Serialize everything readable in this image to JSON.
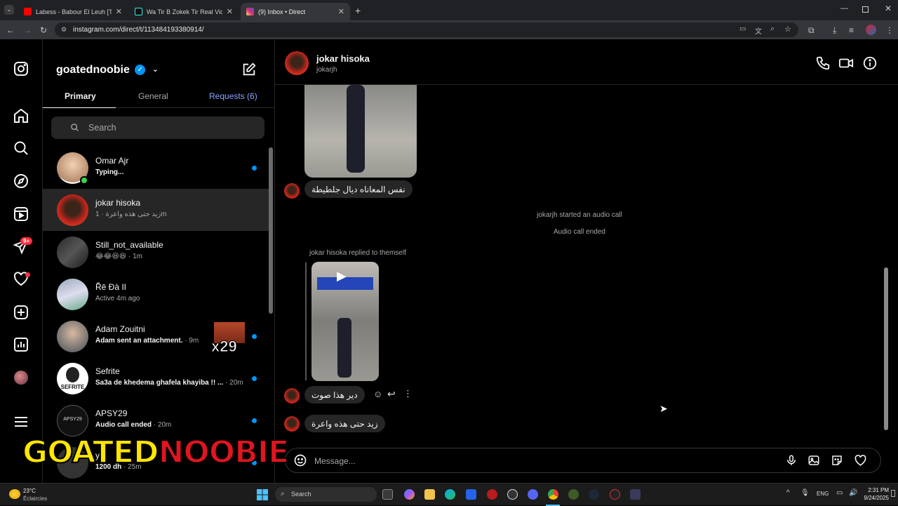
{
  "browser": {
    "tabs": [
      {
        "title": "Labess - Babour El Leuh [Tout v",
        "active": false
      },
      {
        "title": "Wa Tir B Zokek Tir Real Video |",
        "active": false
      },
      {
        "title": "(9) Inbox • Direct",
        "active": true
      }
    ],
    "url": "instagram.com/direct/t/113484193380914/"
  },
  "nav": {
    "notifications_badge": "9+"
  },
  "inbox": {
    "username": "goatednoobie",
    "tabs": {
      "primary": "Primary",
      "general": "General",
      "requests": "Requests (6)"
    },
    "search_placeholder": "Search",
    "threads": [
      {
        "name": "Omar Ajr",
        "preview": "Typing...",
        "time": "",
        "unread": true
      },
      {
        "name": "jokar hisoka",
        "preview": "زيد حتى هذه واعرة",
        "time": " · 1m",
        "unread": false
      },
      {
        "name": "Still_not_available",
        "preview": "😂😂😆😆",
        "time": " · 1m",
        "unread": false
      },
      {
        "name": "Ř̈ē Đà II",
        "preview": "Active 4m ago",
        "time": "",
        "unread": false
      },
      {
        "name": "Adam Zouitni",
        "preview": "Adam sent an attachment.",
        "time": " · 9m",
        "unread": true
      },
      {
        "name": "Sefrite",
        "preview": "Sa3a de khedema ghafela khayiba !! ...",
        "time": " · 20m",
        "unread": true
      },
      {
        "name": "APSY29",
        "preview": "Audio call ended",
        "time": " · 20m",
        "unread": true
      },
      {
        "name": "y",
        "preview": "1200 dh",
        "time": " · 25m",
        "unread": true
      }
    ],
    "sticker_count": "x29",
    "avatar_labels": {
      "sefrite": "SEFRITE",
      "apsy": "APSY29"
    }
  },
  "chat": {
    "name": "jokar hisoka",
    "handle": "jokarjh",
    "messages": {
      "first": "نفس المعاناه ديال جلطيطة",
      "call_started": "jokarjh started an audio call",
      "call_ended": "Audio call ended",
      "replied": "jokar hisoka replied to themself",
      "second": "دير هذا صوت",
      "third": "زيد حتى هذه واعرة"
    },
    "message_placeholder": "Message..."
  },
  "overlay": {
    "part1": "GOATED",
    "part2": "NOOBIE"
  },
  "taskbar": {
    "temperature": "23°C",
    "weather": "Éclaircies",
    "search": "Search",
    "language": "ENG",
    "time": "2:31 PM",
    "date": "9/24/2025"
  }
}
